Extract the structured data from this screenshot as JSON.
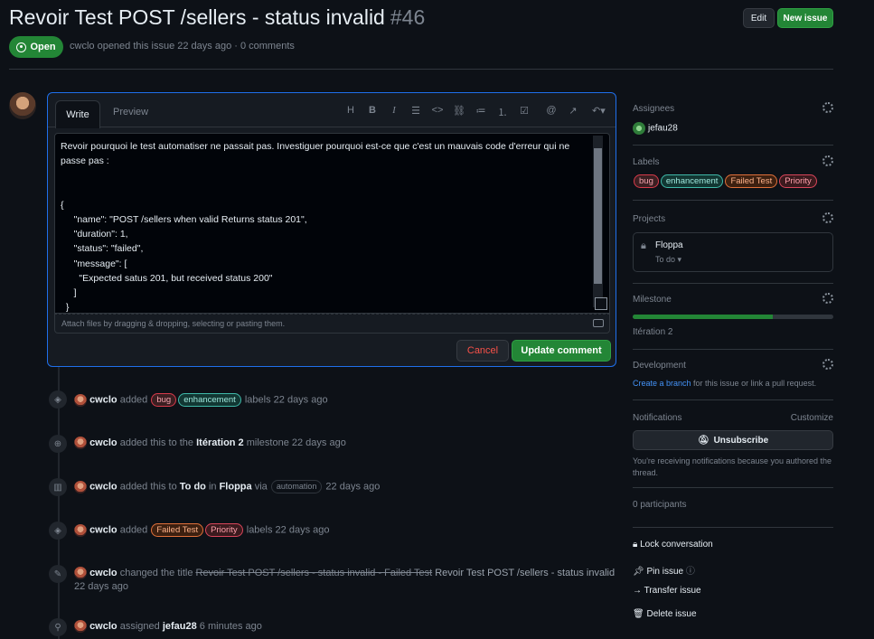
{
  "header": {
    "title": "Revoir Test POST /sellers - status invalid",
    "number": "#46",
    "edit_label": "Edit",
    "new_issue_label": "New issue",
    "state": "Open",
    "author": "cwclo",
    "meta": "opened this issue 22 days ago · 0 comments"
  },
  "editor": {
    "tab_write": "Write",
    "tab_preview": "Preview",
    "toolbar_icons": [
      "heading-icon",
      "bold-icon",
      "italic-icon",
      "quote-icon",
      "code-icon",
      "link-icon",
      "bulleted-list-icon",
      "numbered-list-icon",
      "task-list-icon",
      "mention-icon",
      "reference-icon",
      "undo-icon"
    ],
    "body": "Revoir pourquoi le test automatiser ne passait pas. Investiguer pourquoi est-ce que c'est un mauvais code d'erreur qui ne\npasse pas :\n\n\n{\n     \"name\": \"POST /sellers when valid Returns status 201\",\n     \"duration\": 1,\n     \"status\": \"failed\",\n     \"message\": [\n       \"Expected satus 201, but received status 200\"\n     ]\n  }",
    "attach_hint": "Attach files by dragging & dropping, selecting or pasting them.",
    "cancel_label": "Cancel",
    "update_label": "Update comment"
  },
  "timeline": [
    {
      "icon": "tag-icon",
      "user": "cwclo",
      "pre": "added",
      "labels": [
        "bug",
        "enhancement"
      ],
      "post": "labels 22 days ago"
    },
    {
      "icon": "milestone-icon",
      "user": "cwclo",
      "pre": "added this to the",
      "strong": "Itération 2",
      "post": "milestone 22 days ago"
    },
    {
      "icon": "project-icon",
      "user": "cwclo",
      "pre": "added this to",
      "strong": "To do",
      "mid": "in",
      "strong2": "Floppa",
      "via": "via",
      "badge": "automation",
      "post": "22 days ago"
    },
    {
      "icon": "tag-icon",
      "user": "cwclo",
      "pre": "added",
      "labels": [
        "Failed Test",
        "Priority"
      ],
      "post": "labels 22 days ago"
    },
    {
      "icon": "pencil-icon",
      "user": "cwclo",
      "pre": "changed the title",
      "old": "Revoir Test POST /sellers - status invalid - Failed Test",
      "new": "Revoir Test POST /sellers - status invalid",
      "post": "22 days ago"
    },
    {
      "icon": "person-icon",
      "user": "cwclo",
      "pre": "assigned",
      "strong": "jefau28",
      "post": "6 minutes ago"
    }
  ],
  "sidebar": {
    "assignees_title": "Assignees",
    "assignee": "jefau28",
    "labels_title": "Labels",
    "labels": [
      "bug",
      "enhancement",
      "Failed Test",
      "Priority"
    ],
    "projects_title": "Projects",
    "project_name": "Floppa",
    "project_status": "To do",
    "milestone_title": "Milestone",
    "milestone_progress": 0.7,
    "milestone_name": "Itération 2",
    "development_title": "Development",
    "development_link": "Create a branch",
    "development_text": " for this issue or link a pull request.",
    "notifications_title": "Notifications",
    "customize_label": "Customize",
    "unsubscribe_label": "Unsubscribe",
    "notif_reason": "You're receiving notifications because you authored the thread.",
    "participants": "0 participants",
    "actions": [
      "Lock conversation",
      "Pin issue",
      "Transfer issue",
      "Delete issue"
    ]
  },
  "colors": {
    "accent": "#238636",
    "link": "#4493f8",
    "border_focus": "#1f6feb"
  }
}
